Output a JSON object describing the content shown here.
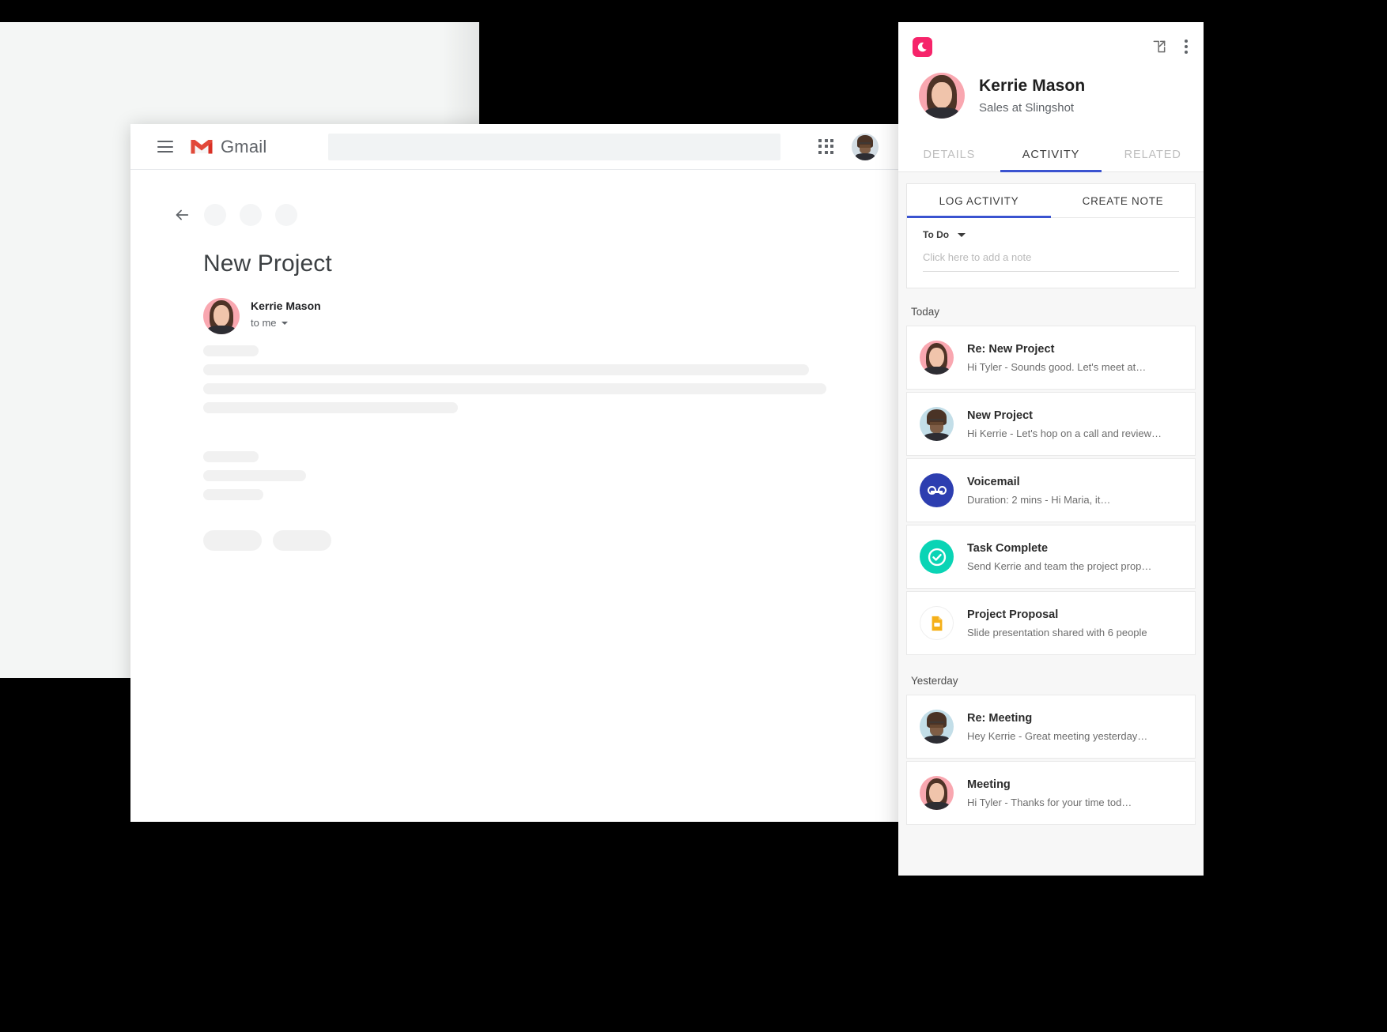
{
  "gmail": {
    "menu_icon": "hamburger-icon",
    "logo_icon": "gmail-logo-icon",
    "brand": "Gmail",
    "search_placeholder": "",
    "apps_icon": "apps-grid-icon",
    "avatar_icon": "user-avatar",
    "back_icon": "back-arrow-icon",
    "subject": "New Project",
    "sender_name": "Kerrie Mason",
    "recipient": "to me",
    "recipient_caret": "chevron-down-icon"
  },
  "crm": {
    "brand_logo_icon": "copper-logo-icon",
    "brand_color": "#f6246a",
    "accent_color": "#3a53d0",
    "open_in_new_icon": "open-in-new-icon",
    "more_icon": "more-vertical-icon",
    "contact": {
      "name": "Kerrie Mason",
      "role": "Sales at Slingshot",
      "avatar_icon": "contact-avatar"
    },
    "tabs": [
      {
        "label": "DETAILS",
        "active": false
      },
      {
        "label": "ACTIVITY",
        "active": true
      },
      {
        "label": "RELATED",
        "active": false
      }
    ],
    "logbox": {
      "tabs": [
        {
          "label": "LOG ACTIVITY",
          "active": true
        },
        {
          "label": "CREATE NOTE",
          "active": false
        }
      ],
      "status_value": "To Do",
      "status_caret_icon": "caret-down-icon",
      "note_placeholder": "Click here to add a note"
    },
    "groups": [
      {
        "label": "Today",
        "items": [
          {
            "icon": "avatar-kerrie",
            "title": "Re: New Project",
            "subtitle": "Hi Tyler -  Sounds good. Let's meet at…"
          },
          {
            "icon": "avatar-tyler",
            "title": "New Project",
            "subtitle": "Hi Kerrie - Let's hop on a call and review…"
          },
          {
            "icon": "voicemail-icon",
            "title": "Voicemail",
            "subtitle": "Duration: 2 mins -  Hi Maria, it…"
          },
          {
            "icon": "task-complete-icon",
            "title": "Task Complete",
            "subtitle": "Send Kerrie and team the project prop…"
          },
          {
            "icon": "google-slides-icon",
            "title": "Project Proposal",
            "subtitle": "Slide presentation shared with 6 people"
          }
        ]
      },
      {
        "label": "Yesterday",
        "items": [
          {
            "icon": "avatar-tyler",
            "title": "Re: Meeting",
            "subtitle": "Hey Kerrie - Great meeting yesterday…"
          },
          {
            "icon": "avatar-kerrie",
            "title": "Meeting",
            "subtitle": "Hi Tyler - Thanks for your time tod…"
          }
        ]
      }
    ]
  }
}
